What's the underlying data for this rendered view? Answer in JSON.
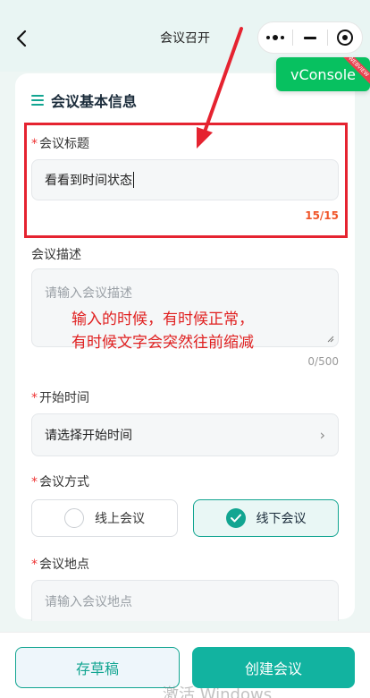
{
  "header": {
    "title": "会议召开"
  },
  "vconsole": {
    "label": "vConsole",
    "ribbon": "WEBVIEW",
    "color": "#07c160"
  },
  "section": {
    "title": "会议基本信息"
  },
  "fields": {
    "title": {
      "label": "会议标题",
      "value": "看看到时间状态",
      "counter": "15/15"
    },
    "description": {
      "label": "会议描述",
      "placeholder": "请输入会议描述",
      "counter": "0/500"
    },
    "start_time": {
      "label": "开始时间",
      "placeholder": "请选择开始时间"
    },
    "method": {
      "label": "会议方式",
      "options": [
        "线上会议",
        "线下会议"
      ],
      "selected": "线下会议"
    },
    "location": {
      "label": "会议地点",
      "placeholder": "请输入会议地点"
    }
  },
  "annotation": {
    "line1": "输入的时候，有时候正常，",
    "line2": "有时候文字会突然往前缩减"
  },
  "footer": {
    "draft_label": "存草稿",
    "create_label": "创建会议"
  },
  "watermark": "激活 Windows",
  "colors": {
    "accent": "#12a591",
    "annotation_red": "#e02020",
    "error_counter": "#f0562a"
  },
  "icons": [
    "back-arrow-icon",
    "more-dots-icon",
    "minimize-icon",
    "close-target-icon",
    "list-icon",
    "chevron-right-icon",
    "radio-icon",
    "check-icon"
  ]
}
